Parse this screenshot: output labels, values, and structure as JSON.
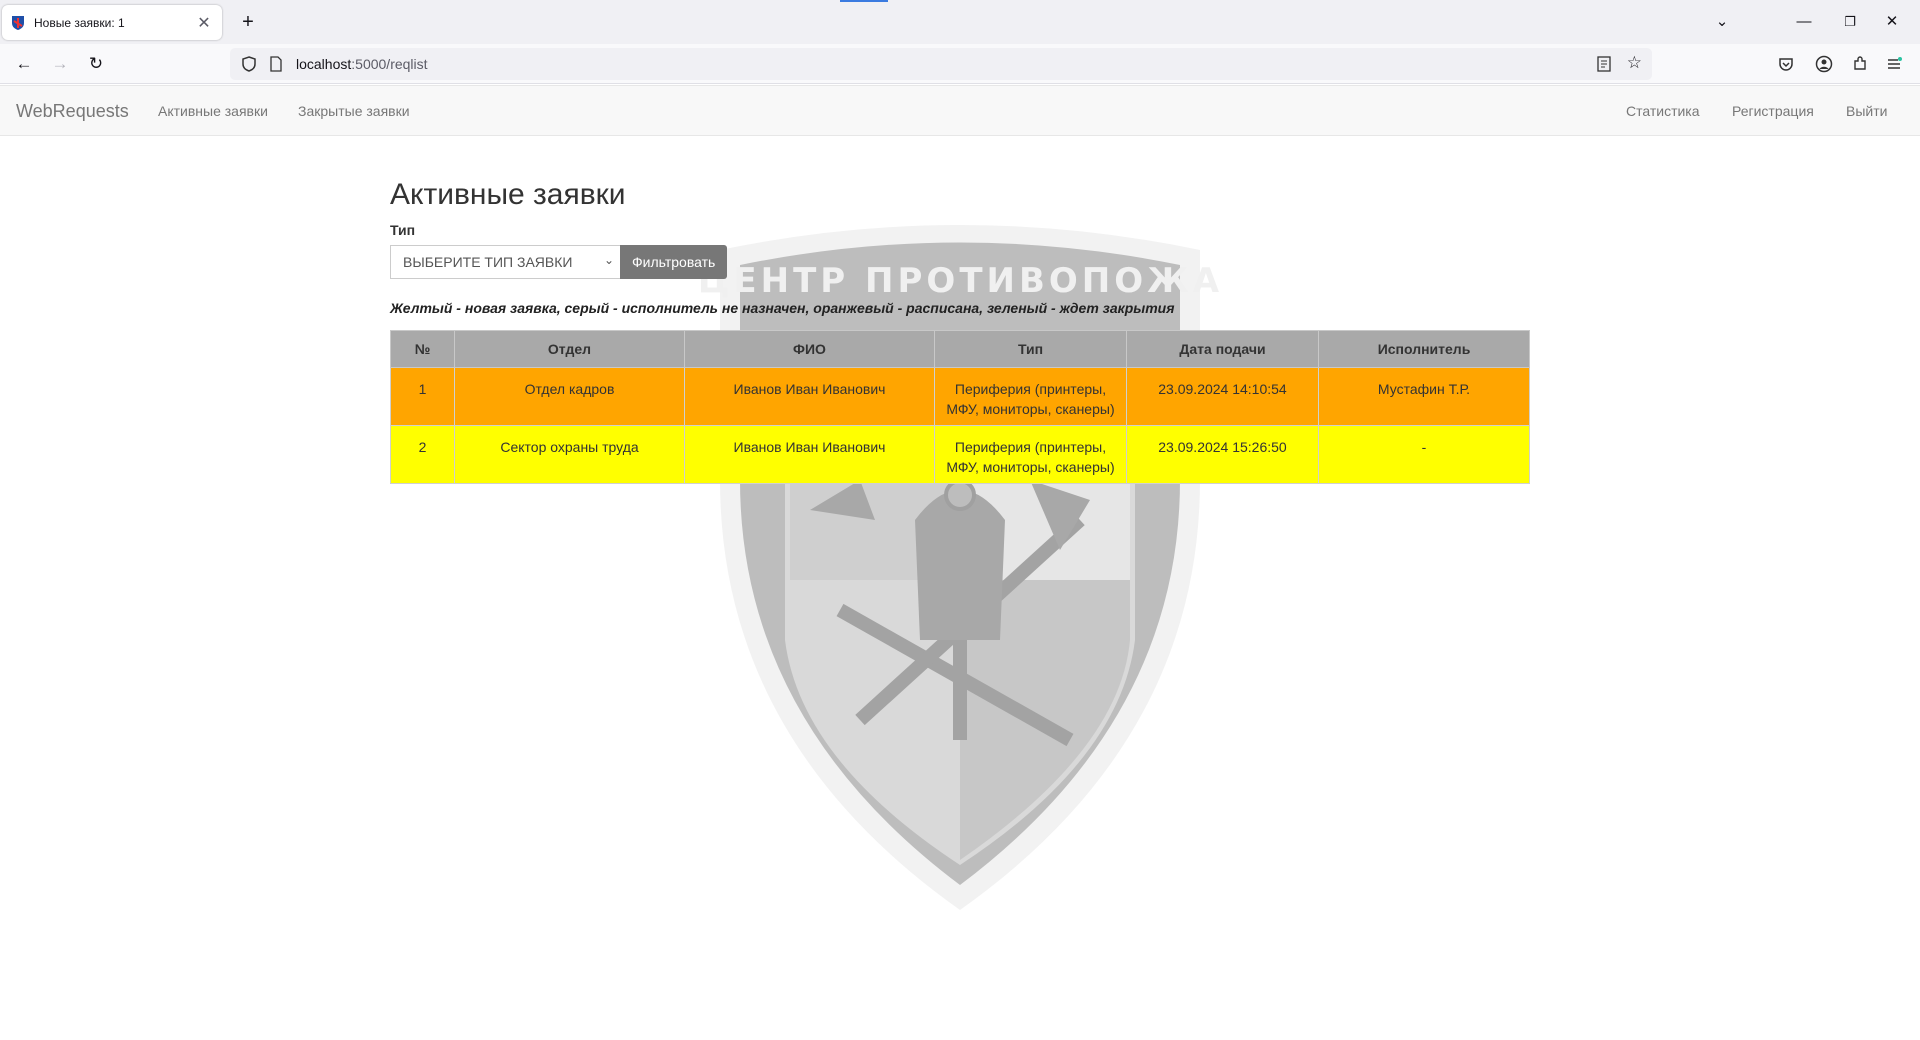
{
  "browser": {
    "tab_title": "Новые заявки: 1",
    "url_host": "localhost",
    "url_path": ":5000/reqlist"
  },
  "site": {
    "brand": "WebRequests",
    "nav_left": [
      "Активные заявки",
      "Закрытые заявки"
    ],
    "nav_right": [
      "Статистика",
      "Регистрация",
      "Выйти"
    ]
  },
  "page": {
    "title": "Активные заявки",
    "filter_label": "Тип",
    "select_value": "ВЫБЕРИТЕ ТИП ЗАЯВКИ",
    "filter_button": "Фильтровать",
    "legend": "Желтый - новая заявка, серый - исполнитель не назначен, оранжевый - расписана, зеленый - ждет закрытия",
    "watermark_text": "ТЕХНИЧЕСКИЙ ЦЕНТР ПРОТИВОПОЖАРНОЙ СЛУЖБЫ"
  },
  "table": {
    "headers": [
      "№",
      "Отдел",
      "ФИО",
      "Тип",
      "Дата подачи",
      "Исполнитель"
    ],
    "rows": [
      {
        "num": "1",
        "dept": "Отдел кадров",
        "fio": "Иванов Иван Иванович",
        "type_line1": "Периферия (принтеры,",
        "type_line2": "МФУ, мониторы, сканеры)",
        "date": "23.09.2024 14:10:54",
        "executor": "Мустафин Т.Р.",
        "color": "#ffa500"
      },
      {
        "num": "2",
        "dept": "Сектор охраны труда",
        "fio": "Иванов Иван Иванович",
        "type_line1": "Периферия (принтеры,",
        "type_line2": "МФУ, мониторы, сканеры)",
        "date": "23.09.2024 15:26:50",
        "executor": "-",
        "color": "#ffff00"
      }
    ]
  }
}
